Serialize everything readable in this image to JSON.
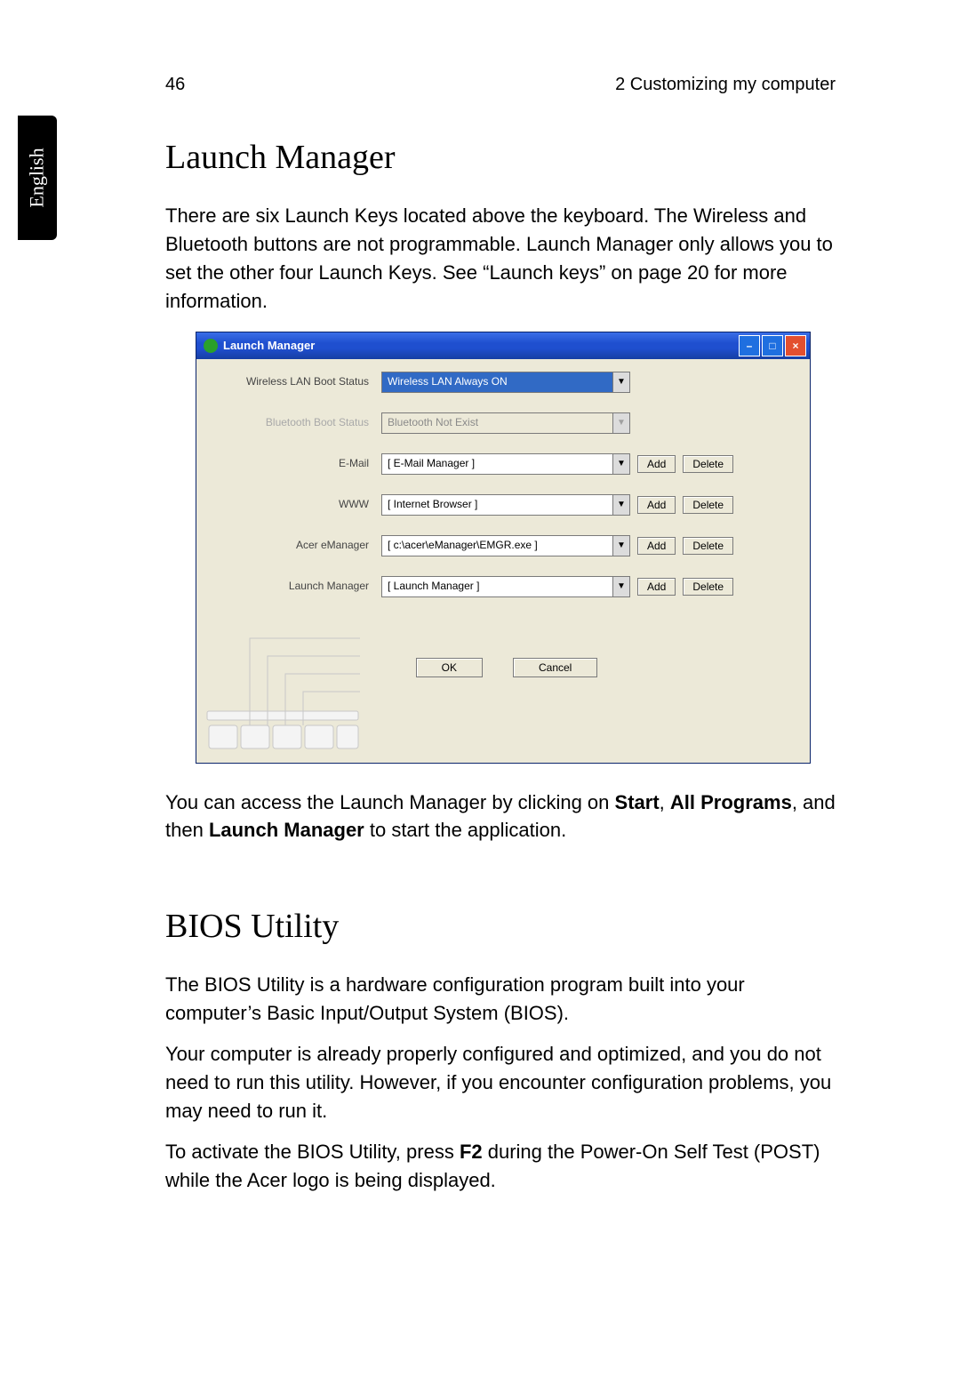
{
  "page_number": "46",
  "chapter": "2 Customizing my computer",
  "side_tab": "English",
  "h1a": "Launch Manager",
  "p1": "There are six Launch Keys located above the keyboard. The Wireless and Bluetooth buttons are not programmable. Launch Manager only allows you to set the other four Launch Keys. See “Launch keys” on page 20 for more information.",
  "p2a": "You can access the Launch Manager by clicking on ",
  "p2b": "Start",
  "p2c": ", ",
  "p2d": "All Programs",
  "p2e": ", and then ",
  "p2f": "Launch Manager",
  "p2g": " to start the application.",
  "h1b": "BIOS Utility",
  "p3": "The BIOS Utility is a hardware configuration program built into your computer’s Basic Input/Output System (BIOS).",
  "p4": "Your computer is already properly configured and optimized, and you do not need to run this utility. However, if you encounter configuration problems, you may need to run it.",
  "p5a": "To activate the BIOS Utility, press ",
  "p5b": "F2",
  "p5c": " during the Power-On Self Test (POST) while the Acer logo is being displayed.",
  "win": {
    "title": "Launch Manager",
    "min": "–",
    "max": "□",
    "close": "×",
    "rows": [
      {
        "label": "Wireless LAN Boot Status",
        "value": "Wireless LAN Always ON",
        "buttons": false,
        "hi": true,
        "disabled": false
      },
      {
        "label": "Bluetooth Boot Status",
        "value": "Bluetooth Not Exist",
        "buttons": false,
        "hi": false,
        "disabled": true
      },
      {
        "label": "E-Mail",
        "value": "[  E-Mail Manager  ]",
        "buttons": true,
        "hi": false,
        "disabled": false
      },
      {
        "label": "WWW",
        "value": "[  Internet Browser  ]",
        "buttons": true,
        "hi": false,
        "disabled": false
      },
      {
        "label": "Acer eManager",
        "value": "[  c:\\acer\\eManager\\EMGR.exe  ]",
        "buttons": true,
        "hi": false,
        "disabled": false
      },
      {
        "label": "Launch Manager",
        "value": "[  Launch Manager  ]",
        "buttons": true,
        "hi": false,
        "disabled": false
      }
    ],
    "add": "Add",
    "delete": "Delete",
    "ok": "OK",
    "cancel": "Cancel"
  }
}
